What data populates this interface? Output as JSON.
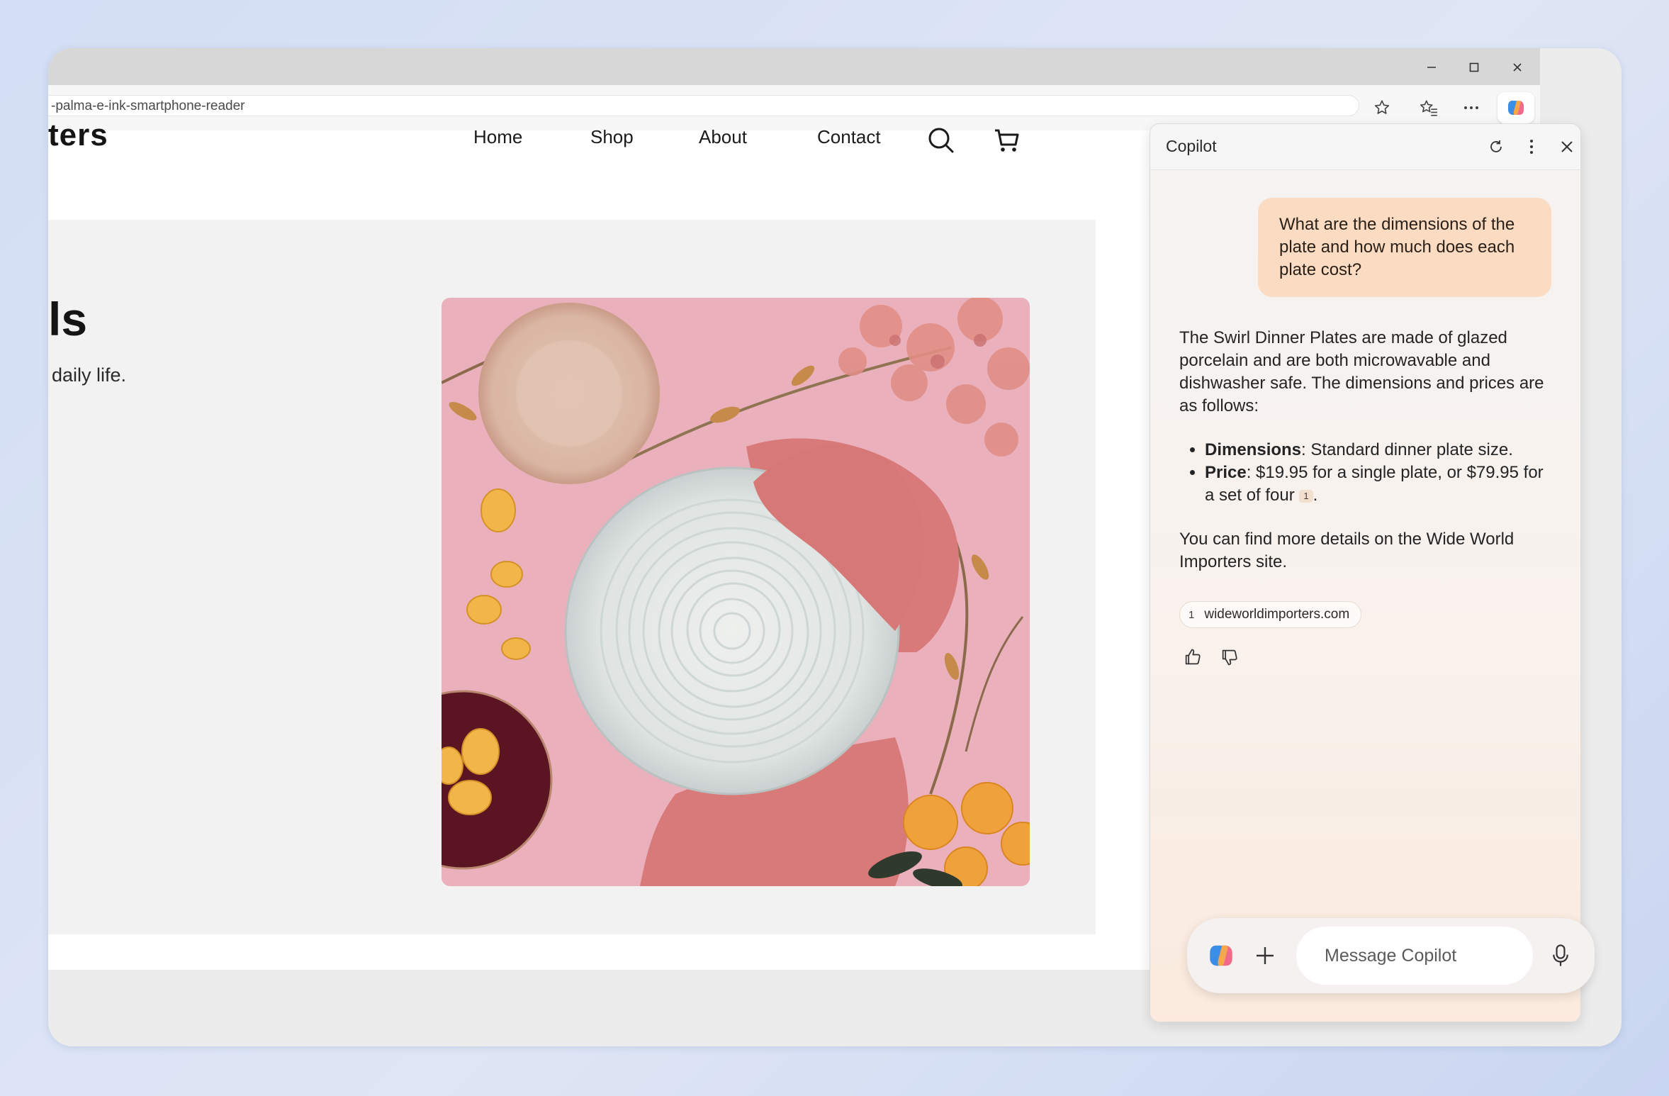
{
  "browser": {
    "url": "-palma-e-ink-smartphone-reader"
  },
  "site": {
    "logo_fragment": "ters",
    "nav": [
      "Home",
      "Shop",
      "About",
      "Contact"
    ],
    "hero_title_fragment": "ls",
    "hero_subtitle_fragment": "daily life."
  },
  "copilot": {
    "title": "Copilot",
    "user_message": "What are the dimensions of the plate and how much does each plate cost?",
    "answer_intro": "The Swirl Dinner Plates are made of glazed porcelain and are both microwavable and dishwasher safe. The dimensions and prices are as follows:",
    "bullets": [
      {
        "label": "Dimensions",
        "text": ": Standard dinner plate size."
      },
      {
        "label": "Price",
        "text": ": $19.95 for a single plate, or $79.95 for a set of four",
        "citation": "1",
        "trail": "."
      }
    ],
    "answer_outro": "You can find more details on the Wide World Importers site.",
    "source": {
      "number": "1",
      "domain": "wideworldimporters.com"
    },
    "composer_placeholder": "Message Copilot"
  },
  "colors": {
    "user_bubble": "#fbdcc2",
    "hero_bg": "#f2f2f2",
    "image_bg": "#e9a8b6"
  },
  "icons": [
    "minimize-icon",
    "maximize-icon",
    "close-icon",
    "star-icon",
    "favorites-icon",
    "more-icon",
    "copilot-icon",
    "search-icon",
    "cart-icon",
    "refresh-icon",
    "kebab-icon",
    "thumbs-up-icon",
    "thumbs-down-icon",
    "plus-icon",
    "mic-icon"
  ]
}
